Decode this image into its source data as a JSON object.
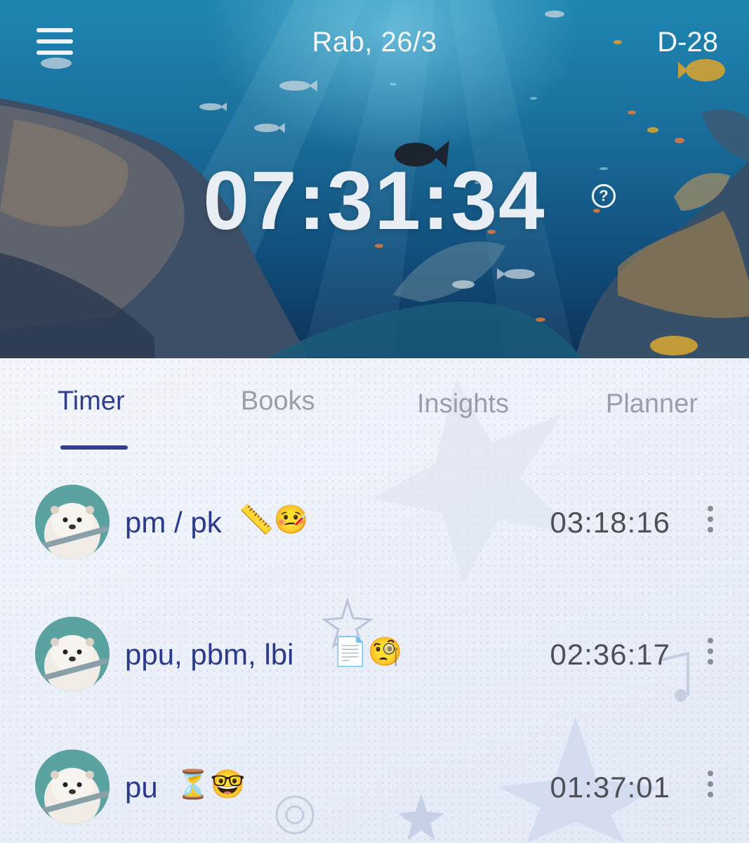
{
  "header": {
    "date": "Rab, 26/3",
    "dday": "D-28",
    "menu_icon": "hamburger-menu-icon"
  },
  "main_timer": {
    "value": "07:31:34",
    "help_icon": "question-circle-icon",
    "help_glyph": "?"
  },
  "tabs": [
    {
      "label": "Timer",
      "active": true
    },
    {
      "label": "Books",
      "active": false
    },
    {
      "label": "Insights",
      "active": false
    },
    {
      "label": "Planner",
      "active": false
    }
  ],
  "subjects": [
    {
      "name": "pm / pk",
      "emojis": "📏🤒",
      "time": "03:18:16",
      "avatar": "otter-avatar"
    },
    {
      "name": "ppu, pbm, lbi",
      "emojis": "📄🧐",
      "time": "02:36:17",
      "avatar": "otter-avatar"
    },
    {
      "name": "pu",
      "emojis": "⏳🤓",
      "time": "01:37:01",
      "avatar": "otter-avatar"
    }
  ],
  "colors": {
    "accent": "#2f3f8e",
    "tab_inactive": "#9a9ea8",
    "time_text": "#4e5056"
  }
}
